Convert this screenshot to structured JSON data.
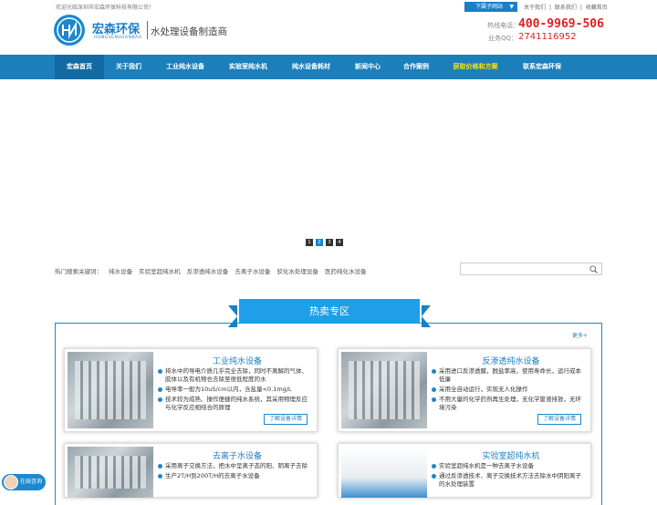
{
  "topbar": {
    "welcome": "欢迎光临深圳市宏森环保科技有限公司！",
    "sub_site": "下属子网站",
    "links": [
      "关于我们",
      "|",
      "联系我们",
      "|",
      "收藏首页"
    ]
  },
  "header": {
    "brand_cn": "宏森环保",
    "brand_en": "HONGSENHUANBAO",
    "slogan": "水处理设备制造商",
    "hotline_label": "热线电话：",
    "hotline": "400-9969-506",
    "qq_label": "业务QQ：",
    "qq": "2741116952"
  },
  "nav": [
    {
      "label": "宏森首页",
      "active": true
    },
    {
      "label": "关于我们"
    },
    {
      "label": "工业纯水设备"
    },
    {
      "label": "实验室纯水机"
    },
    {
      "label": "纯水设备耗材"
    },
    {
      "label": "新闻中心"
    },
    {
      "label": "合作案例"
    },
    {
      "label": "获取价格和方案",
      "highlight": true
    },
    {
      "label": "联系宏森环保"
    }
  ],
  "slider": {
    "dots": [
      "1",
      "2",
      "3",
      "4"
    ],
    "active": 2
  },
  "hotwords": {
    "label": "热门搜索关键词：",
    "items": [
      "纯水设备",
      "实验室超纯水机",
      "反渗透纯水设备",
      "去离子水设备",
      "软化水处理设备",
      "医药纯化水设备"
    ]
  },
  "search": {
    "placeholder": ""
  },
  "section": {
    "title": "热卖专区",
    "more": "更多+"
  },
  "products": [
    {
      "title": "工业纯水设备",
      "bullets": [
        "将水中的导电介质几乎完全去除，同时不离解的气体、胶体以及有机物也去除至很低程度的水",
        "电导率一般为10uS/cm以内，含盐量<0.1mg/L",
        "技术较为成熟、操作便捷的纯水系统，其采用物理反应与化学反应相结合的原理"
      ],
      "button": "了解设备详情"
    },
    {
      "title": "反渗透纯水设备",
      "bullets": [
        "采用进口反渗透膜，脱盐率高，使用寿命长，运行成本低廉",
        "采用全自动运行，实现无人化操作",
        "不用大量的化学药剂再生处理，无化学废液排放，无环境污染"
      ],
      "button": "了解设备详情"
    },
    {
      "title": "去离子水设备",
      "bullets": [
        "采用离子交换方法，把水中呈离子态的阳、阴离子去除",
        "生产2T/H到200T/H的去离子水设备"
      ],
      "button": ""
    },
    {
      "title": "实验室超纯水机",
      "bullets": [
        "实验室超纯水机是一种去离子水设备",
        "通过反渗透技术、离子交换技术方法去除水中阴阳离子的水处理装置"
      ],
      "button": ""
    }
  ],
  "chat": {
    "label": "在线咨询"
  },
  "colors": {
    "primary": "#1b7fbb",
    "accent": "#1e9fe8",
    "phone": "#e02020",
    "nav_highlight": "#ffe600"
  }
}
